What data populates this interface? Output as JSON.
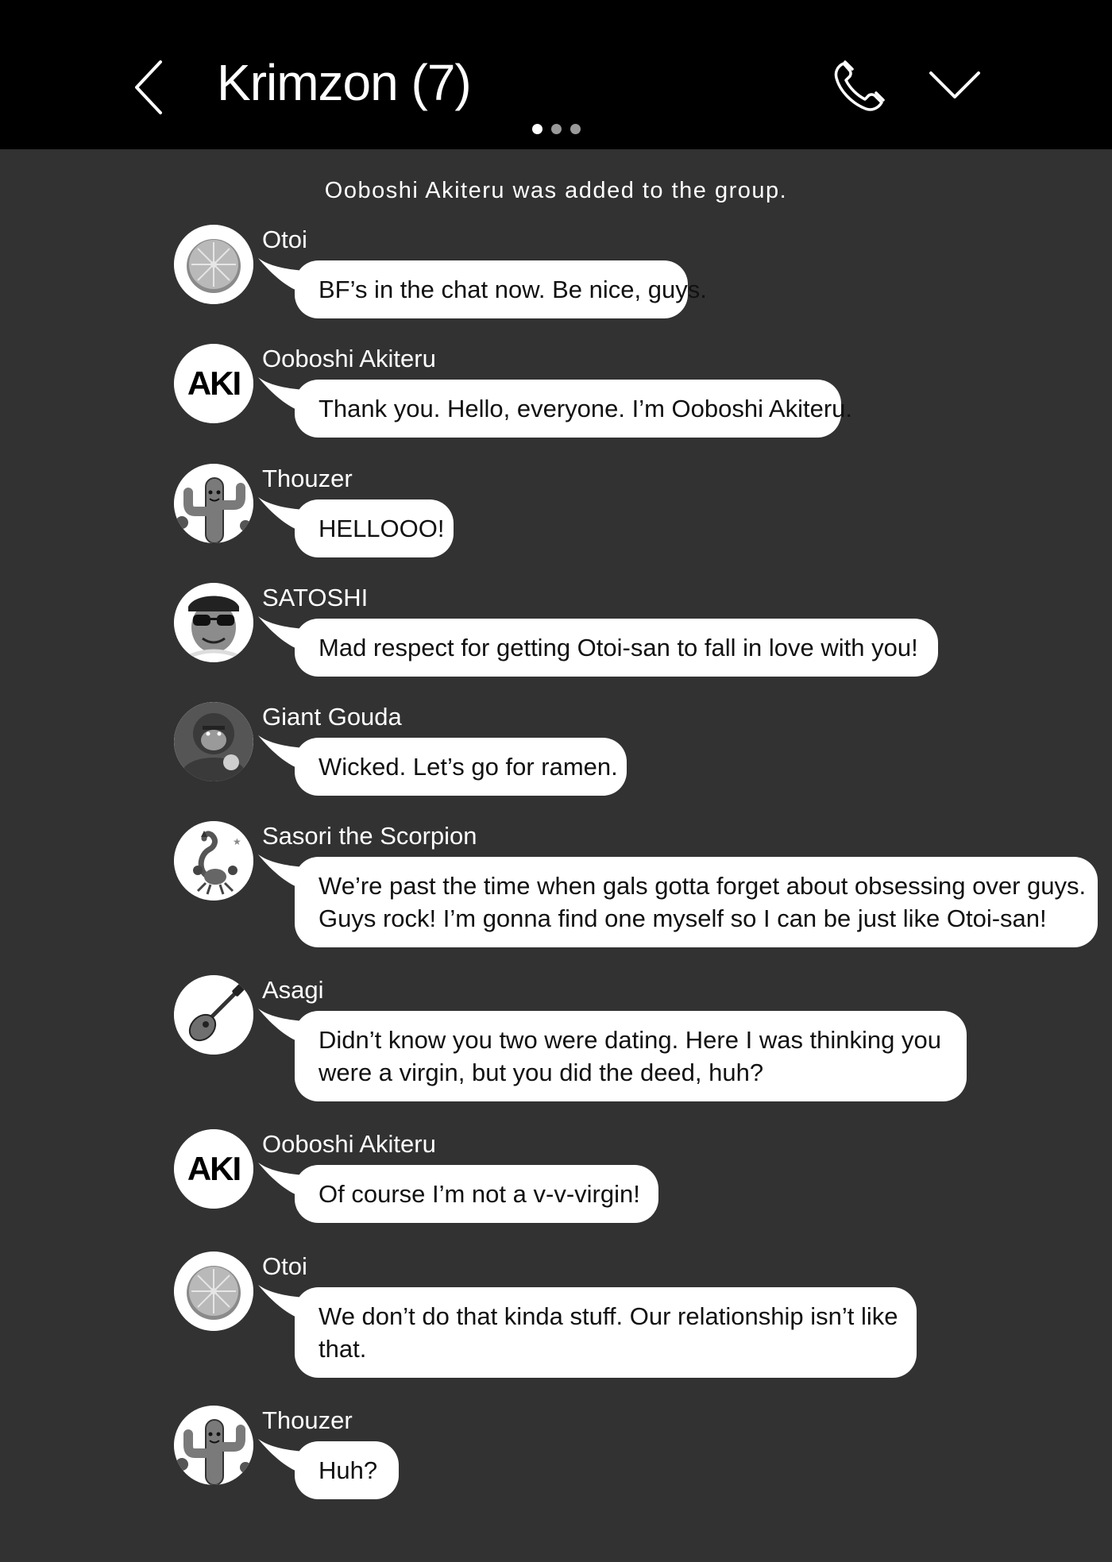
{
  "header": {
    "title": "Krimzon (7)",
    "page_indicator": {
      "pages": 3,
      "active": 1
    }
  },
  "system_message": "Ooboshi Akiteru was added to the group.",
  "messages": [
    {
      "sender": "Otoi",
      "avatar": "orange-slice-avatar",
      "lines": [
        "BF’s in the chat now. Be nice, guys."
      ]
    },
    {
      "sender": "Ooboshi Akiteru",
      "avatar": "aki-text-avatar",
      "avatar_text": "AKI",
      "lines": [
        "Thank you. Hello, everyone. I’m Ooboshi Akiteru."
      ]
    },
    {
      "sender": "Thouzer",
      "avatar": "cactus-avatar",
      "lines": [
        "HELLOOO!"
      ]
    },
    {
      "sender": "SATOSHI",
      "avatar": "sunglasses-man-avatar",
      "lines": [
        "Mad respect for getting Otoi-san to fall in love with you!"
      ]
    },
    {
      "sender": "Giant Gouda",
      "avatar": "gorilla-avatar",
      "lines": [
        "Wicked. Let’s go for ramen."
      ]
    },
    {
      "sender": "Sasori the Scorpion",
      "avatar": "scorpion-avatar",
      "lines": [
        "We’re past the time when gals gotta forget about obsessing over guys.",
        "Guys rock! I’m gonna find one myself so I can be just like Otoi-san!"
      ]
    },
    {
      "sender": "Asagi",
      "avatar": "guitar-avatar",
      "lines": [
        "Didn’t know you two were dating. Here I was thinking you",
        "were a virgin, but you did the deed, huh?"
      ]
    },
    {
      "sender": "Ooboshi Akiteru",
      "avatar": "aki-text-avatar",
      "avatar_text": "AKI",
      "lines": [
        "Of course I’m not a v-v-virgin!"
      ]
    },
    {
      "sender": "Otoi",
      "avatar": "orange-slice-avatar",
      "lines": [
        "We don’t do that kinda stuff. Our relationship isn’t like",
        "that."
      ]
    },
    {
      "sender": "Thouzer",
      "avatar": "cactus-avatar",
      "lines": [
        "Huh?"
      ]
    }
  ]
}
